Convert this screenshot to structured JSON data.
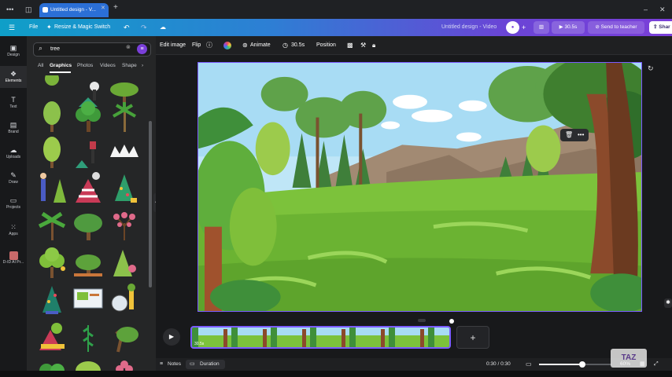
{
  "browser": {
    "tab_title": "Untitled design - V...",
    "icons": [
      "menu-dots-icon",
      "tab-grid-icon",
      "new-tab-plus-icon",
      "minimize-icon",
      "close-icon"
    ]
  },
  "topbar": {
    "file": "File",
    "resize": "Resize & Magic Switch",
    "doc_title": "Untitled design - Video",
    "play_time": "30.5s",
    "send": "Send to teacher",
    "share": "Shar",
    "gradient_start": "#0f9fc8",
    "gradient_end": "#7a3fd9"
  },
  "rail": {
    "items": [
      {
        "label": "Design",
        "icon": "layout-icon"
      },
      {
        "label": "Elements",
        "icon": "shapes-icon"
      },
      {
        "label": "Text",
        "icon": "text-icon"
      },
      {
        "label": "Brand",
        "icon": "brand-icon"
      },
      {
        "label": "Uploads",
        "icon": "cloud-upload-icon"
      },
      {
        "label": "Draw",
        "icon": "pen-icon"
      },
      {
        "label": "Projects",
        "icon": "folder-icon"
      },
      {
        "label": "Apps",
        "icon": "apps-grid-icon"
      },
      {
        "label": "D-ID AI Pr...",
        "icon": "avatar-icon"
      }
    ]
  },
  "panel": {
    "search_value": "tree",
    "tabs": [
      "All",
      "Graphics",
      "Photos",
      "Videos",
      "Shape"
    ],
    "active_tab": "Graphics"
  },
  "edit_toolbar": {
    "edit_image": "Edit image",
    "flip": "Flip",
    "animate": "Animate",
    "duration": "30.5s",
    "position": "Position"
  },
  "timeline": {
    "clip_duration": "30.5s",
    "add_label": "+"
  },
  "bottombar": {
    "notes": "Notes",
    "duration": "Duration",
    "timecode": "0:30 / 0:30",
    "zoom": "60%",
    "zoom_fraction": 0.6
  },
  "watermark": "TAZ"
}
